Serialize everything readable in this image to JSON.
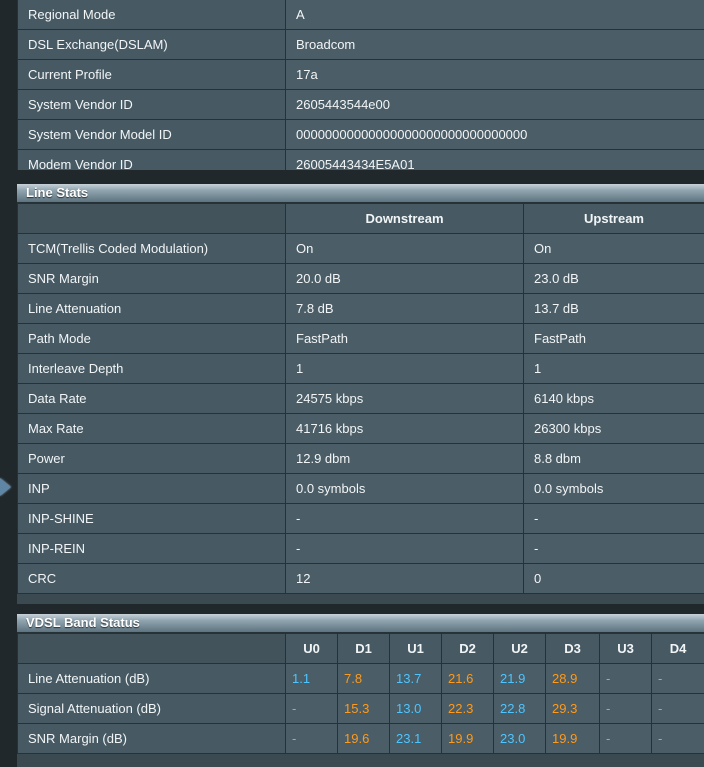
{
  "colors": {
    "upstream_band_text": "#4ec5ff",
    "downstream_band_text": "#ff9a1a",
    "arrow": "#5f86a5"
  },
  "info": {
    "rows": [
      {
        "label": "Regional Mode",
        "value": "A"
      },
      {
        "label": "DSL Exchange(DSLAM)",
        "value": "Broadcom"
      },
      {
        "label": "Current Profile",
        "value": "17a"
      },
      {
        "label": "System Vendor ID",
        "value": "2605443544e00"
      },
      {
        "label": "System Vendor Model ID",
        "value": "00000000000000000000000000000000"
      },
      {
        "label": "Modem Vendor ID",
        "value": "26005443434E5A01"
      }
    ]
  },
  "line_stats": {
    "title": "Line Stats",
    "headers": {
      "downstream": "Downstream",
      "upstream": "Upstream"
    },
    "rows": [
      {
        "label": "TCM(Trellis Coded Modulation)",
        "down": "On",
        "up": "On"
      },
      {
        "label": "SNR Margin",
        "down": "20.0 dB",
        "up": "23.0 dB"
      },
      {
        "label": "Line Attenuation",
        "down": "7.8 dB",
        "up": "13.7 dB"
      },
      {
        "label": "Path Mode",
        "down": "FastPath",
        "up": "FastPath"
      },
      {
        "label": "Interleave Depth",
        "down": "1",
        "up": "1"
      },
      {
        "label": "Data Rate",
        "down": "24575 kbps",
        "up": "6140 kbps"
      },
      {
        "label": "Max Rate",
        "down": "41716 kbps",
        "up": "26300 kbps"
      },
      {
        "label": "Power",
        "down": "12.9 dbm",
        "up": "8.8 dbm"
      },
      {
        "label": "INP",
        "down": "0.0 symbols",
        "up": "0.0 symbols"
      },
      {
        "label": "INP-SHINE",
        "down": "-",
        "up": "-"
      },
      {
        "label": "INP-REIN",
        "down": "-",
        "up": "-"
      },
      {
        "label": "CRC",
        "down": "12",
        "up": "0"
      }
    ]
  },
  "vdsl_band_status": {
    "title": "VDSL Band Status",
    "bands": [
      "U0",
      "D1",
      "U1",
      "D2",
      "U2",
      "D3",
      "U3",
      "D4"
    ],
    "rows": [
      {
        "label": "Line Attenuation (dB)",
        "values": [
          "1.1",
          "7.8",
          "13.7",
          "21.6",
          "21.9",
          "28.9",
          "-",
          "-"
        ]
      },
      {
        "label": "Signal Attenuation (dB)",
        "values": [
          "-",
          "15.3",
          "13.0",
          "22.3",
          "22.8",
          "29.3",
          "-",
          "-"
        ]
      },
      {
        "label": "SNR Margin (dB)",
        "values": [
          "-",
          "19.6",
          "23.1",
          "19.9",
          "23.0",
          "19.9",
          "-",
          "-"
        ]
      }
    ]
  }
}
